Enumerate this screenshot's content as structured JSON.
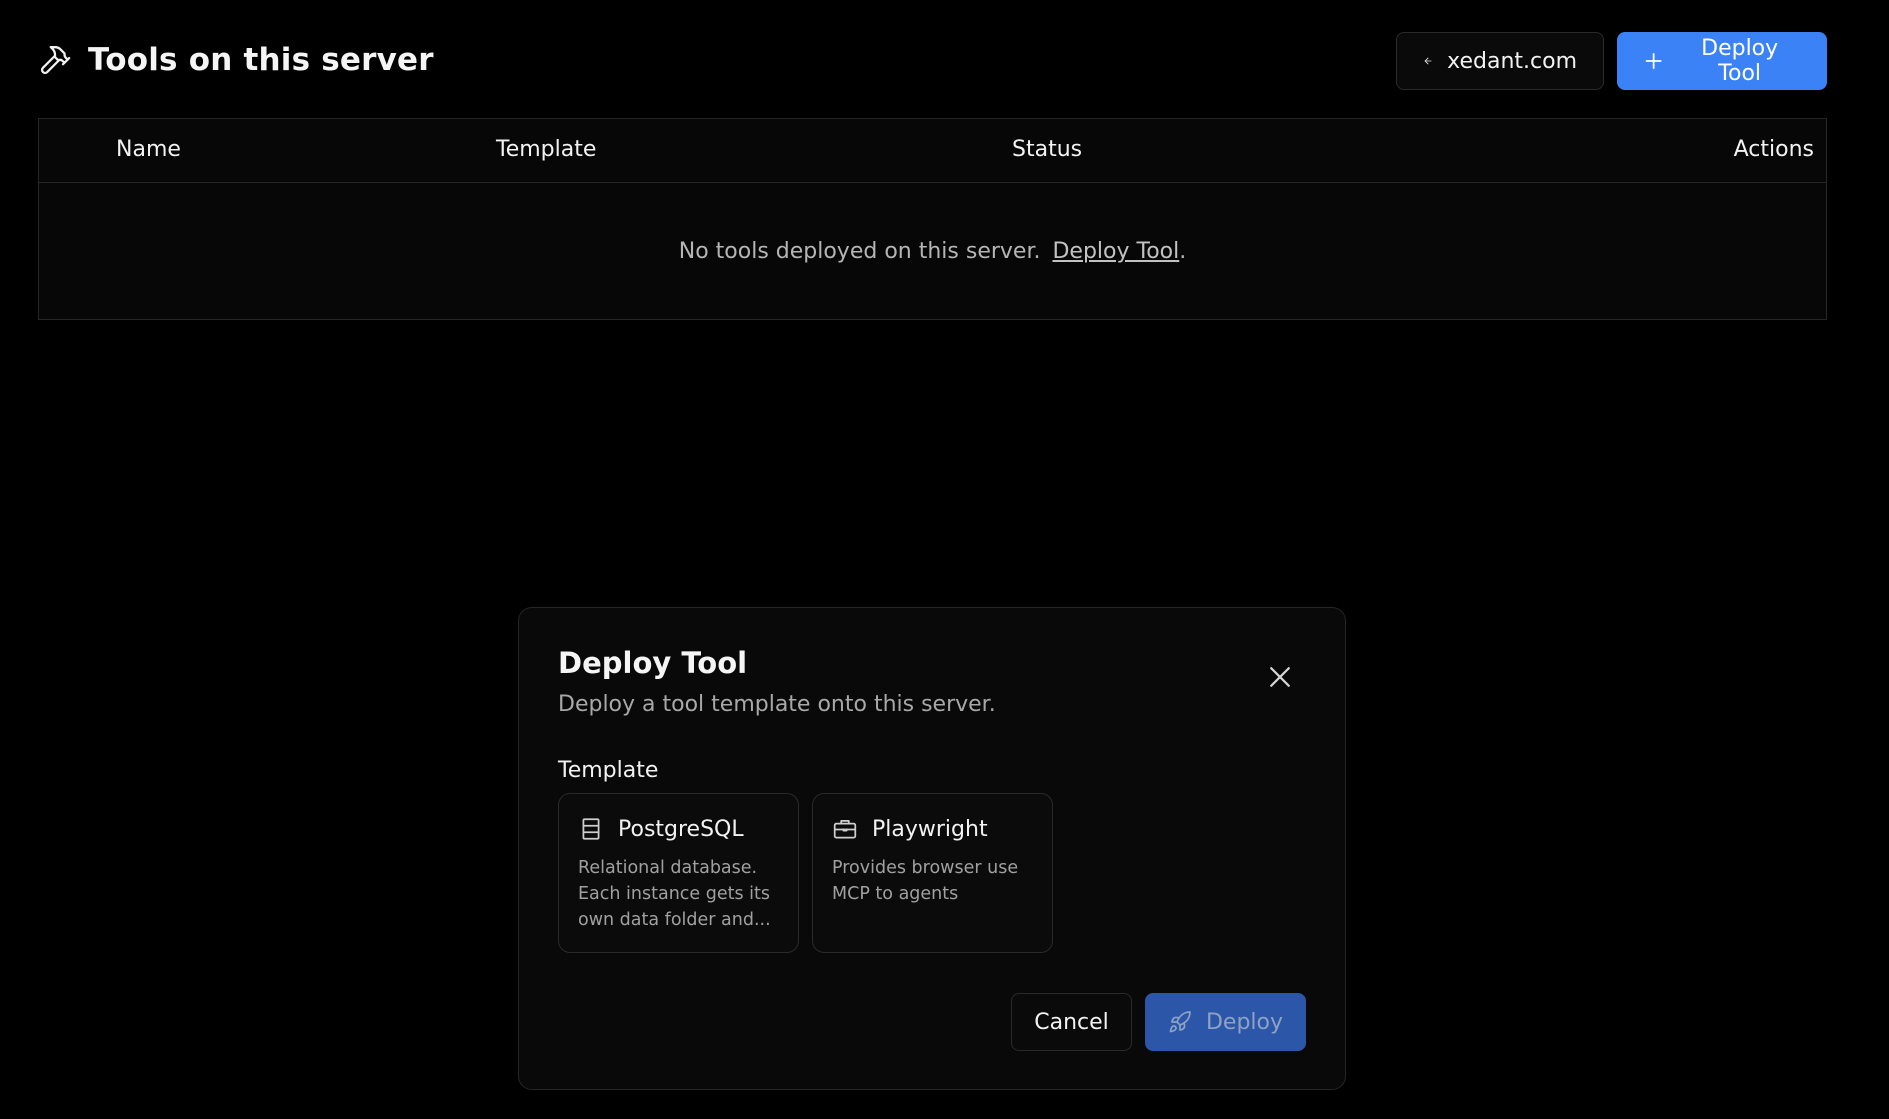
{
  "header": {
    "title": "Tools on this server",
    "title_icon": "hammer-icon",
    "back_button": {
      "label": "xedant.com",
      "icon": "arrow-left-icon"
    },
    "deploy_button": {
      "label": "Deploy Tool",
      "icon": "plus-icon"
    }
  },
  "table": {
    "columns": [
      "Name",
      "Template",
      "Status",
      "Actions"
    ],
    "empty_message": "No tools deployed on this server.",
    "empty_link": "Deploy Tool",
    "empty_suffix": "."
  },
  "modal": {
    "title": "Deploy Tool",
    "subtitle": "Deploy a tool template onto this server.",
    "close_icon": "close-icon",
    "template_label": "Template",
    "templates": [
      {
        "name": "PostgreSQL",
        "icon": "database-icon",
        "description": "Relational database. Each instance gets its own data folder and..."
      },
      {
        "name": "Playwright",
        "icon": "briefcase-icon",
        "description": "Provides browser use MCP to agents"
      }
    ],
    "cancel_label": "Cancel",
    "deploy_label": "Deploy",
    "deploy_icon": "rocket-icon"
  },
  "colors": {
    "background": "#000000",
    "primary": "#3b82f6",
    "primary_disabled": "#2c56a8",
    "border": "#262626"
  }
}
